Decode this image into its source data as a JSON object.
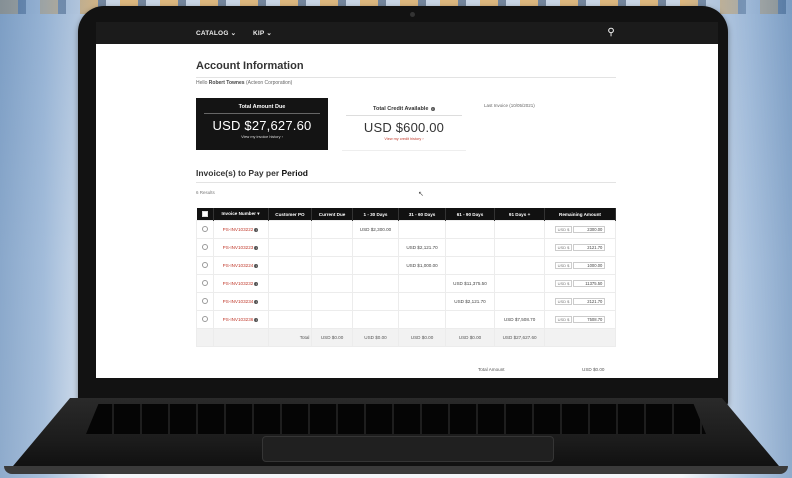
{
  "nav": {
    "catalog": "CATALOG",
    "kip": "KIP"
  },
  "account": {
    "title": "Account Information",
    "hello_prefix": "Hello",
    "user": "Robert Townes",
    "company": "(Acteon Corporation)",
    "due_label": "Total Amount Due",
    "due_amount": "USD $27,627.60",
    "due_link": "View my invoice history ›",
    "credit_label": "Total Credit Available",
    "credit_amount": "USD $600.00",
    "credit_link": "View my credit history ›",
    "last_invoice": "Last Invoice (10/05/2021)"
  },
  "invoices": {
    "title_prefix": "Invoice(s) to Pay per",
    "title_emph": "Period",
    "results": "6 Results",
    "headers": [
      "Invoice Number ▾",
      "Customer PO",
      "Current Due",
      "1 - 30 Days",
      "31 - 60 Days",
      "61 - 90 Days",
      "91 Days +",
      "Remaining Amount"
    ],
    "currency_prefix": "USD $",
    "rows": [
      {
        "invoice": "PS-INV103222",
        "po": "",
        "current": "",
        "d30": "USD $2,300.00",
        "d60": "",
        "d90": "",
        "d91": "",
        "remaining": "2300.00"
      },
      {
        "invoice": "PS-INV103223",
        "po": "",
        "current": "",
        "d30": "",
        "d60": "USD $2,121.70",
        "d90": "",
        "d91": "",
        "remaining": "2121.70"
      },
      {
        "invoice": "PS-INV103224",
        "po": "",
        "current": "",
        "d30": "",
        "d60": "USD $1,000.00",
        "d90": "",
        "d91": "",
        "remaining": "1000.00"
      },
      {
        "invoice": "PS-INV103232",
        "po": "",
        "current": "",
        "d30": "",
        "d60": "",
        "d90": "USD $11,375.50",
        "d91": "",
        "remaining": "11375.50"
      },
      {
        "invoice": "PS-INV103234",
        "po": "",
        "current": "",
        "d30": "",
        "d60": "",
        "d90": "USD $2,121.70",
        "d91": "",
        "remaining": "2121.70"
      },
      {
        "invoice": "PS-INV103236",
        "po": "",
        "current": "",
        "d30": "",
        "d60": "",
        "d90": "",
        "d91": "USD $7,508.70",
        "remaining": "7508.70"
      }
    ],
    "totals": {
      "label": "Total",
      "current": "USD $0.00",
      "d30": "USD $0.00",
      "d60": "USD $0.00",
      "d90": "USD $0.00",
      "d91": "USD $27,627.60"
    },
    "total_amount_label": "Total Amount",
    "total_amount_value": "USD $0.00"
  }
}
